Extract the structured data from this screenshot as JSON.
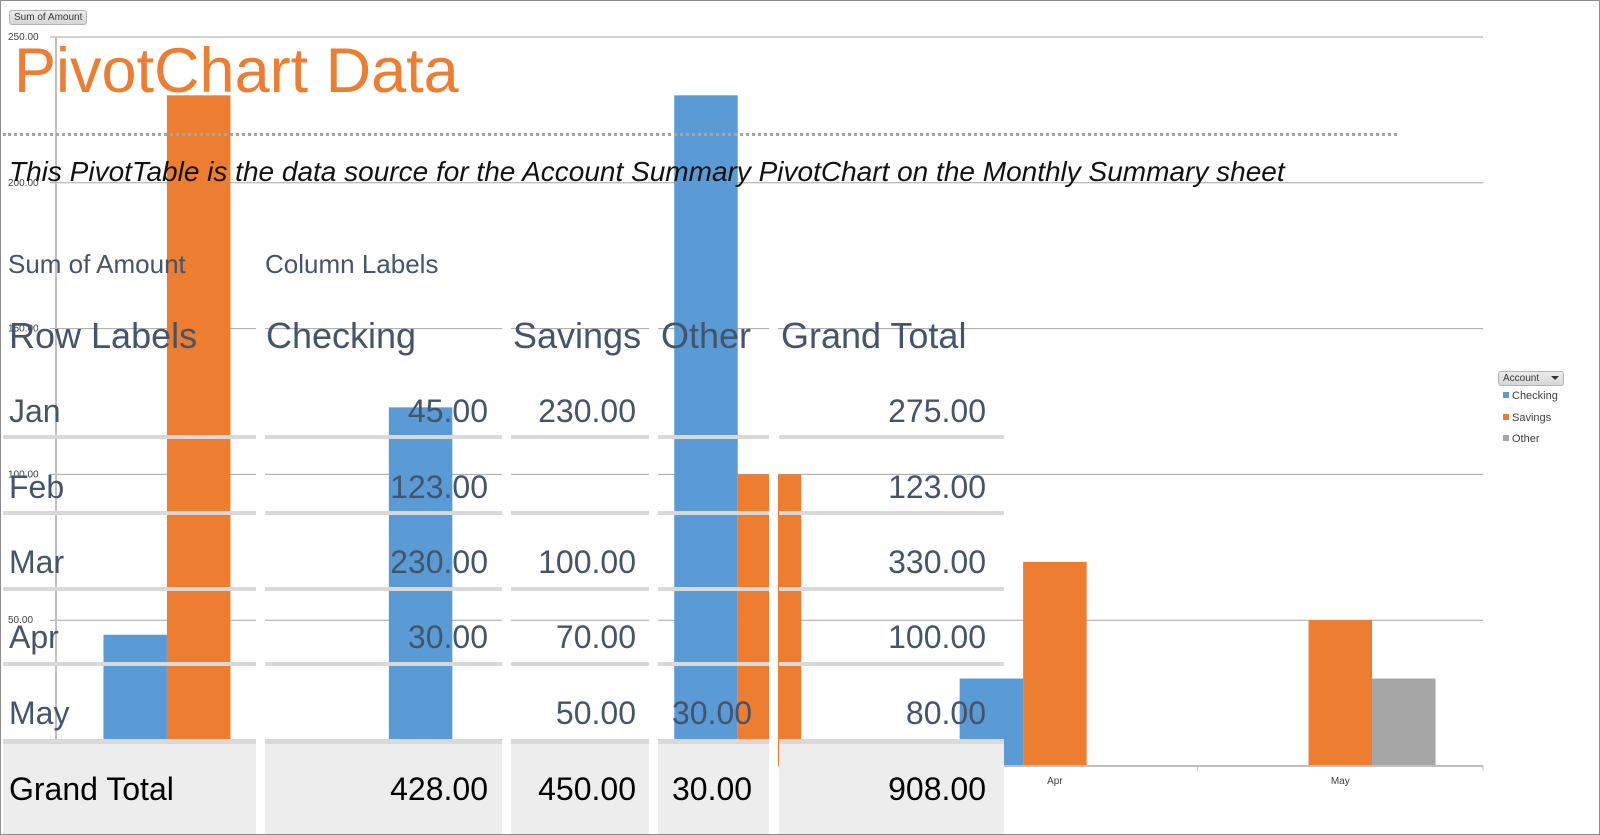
{
  "sheet": {
    "title": "PivotChart Data",
    "subtitle": "This PivotTable is the data source for the Account Summary PivotChart on the Monthly Summary sheet"
  },
  "pivot_table": {
    "value_field_label": "Sum of Amount",
    "column_labels_label": "Column Labels",
    "row_labels_header": "Row Labels",
    "columns": [
      "Checking",
      "Savings",
      "Other",
      "Grand Total"
    ],
    "rows": [
      {
        "label": "Jan",
        "checking": "45.00",
        "savings": "230.00",
        "other": "",
        "total": "275.00"
      },
      {
        "label": "Feb",
        "checking": "123.00",
        "savings": "",
        "other": "",
        "total": "123.00"
      },
      {
        "label": "Mar",
        "checking": "230.00",
        "savings": "100.00",
        "other": "",
        "total": "330.00"
      },
      {
        "label": "Apr",
        "checking": "30.00",
        "savings": "70.00",
        "other": "",
        "total": "100.00"
      },
      {
        "label": "May",
        "checking": "",
        "savings": "50.00",
        "other": "30.00",
        "total": "80.00"
      }
    ],
    "grand_total": {
      "label": "Grand Total",
      "checking": "428.00",
      "savings": "450.00",
      "other": "30.00",
      "total": "908.00"
    }
  },
  "chart_controls": {
    "value_field_button": "Sum of Amount",
    "legend_field_button": "Account"
  },
  "colors": {
    "checking": "#5b9bd5",
    "savings": "#ed7d31",
    "other": "#a5a5a5",
    "title": "#ed7d31",
    "header_text": "#44546a"
  },
  "chart_data": {
    "type": "bar",
    "title": "",
    "xlabel": "",
    "ylabel": "",
    "categories": [
      "Jan",
      "Feb",
      "Mar",
      "Apr",
      "May"
    ],
    "visible_category_labels": [
      "Apr",
      "May"
    ],
    "series": [
      {
        "name": "Checking",
        "values": [
          45,
          123,
          230,
          30,
          0
        ]
      },
      {
        "name": "Savings",
        "values": [
          230,
          0,
          100,
          70,
          50
        ]
      },
      {
        "name": "Other",
        "values": [
          0,
          0,
          0,
          0,
          30
        ]
      }
    ],
    "ylim": [
      0,
      250
    ],
    "yticks": [
      "0",
      "50.00",
      "100.00",
      "150.00",
      "200.00",
      "250.00"
    ],
    "grid": true,
    "legend": {
      "title": "Account",
      "placement": "right",
      "entries": [
        "Checking",
        "Savings",
        "Other"
      ]
    }
  }
}
